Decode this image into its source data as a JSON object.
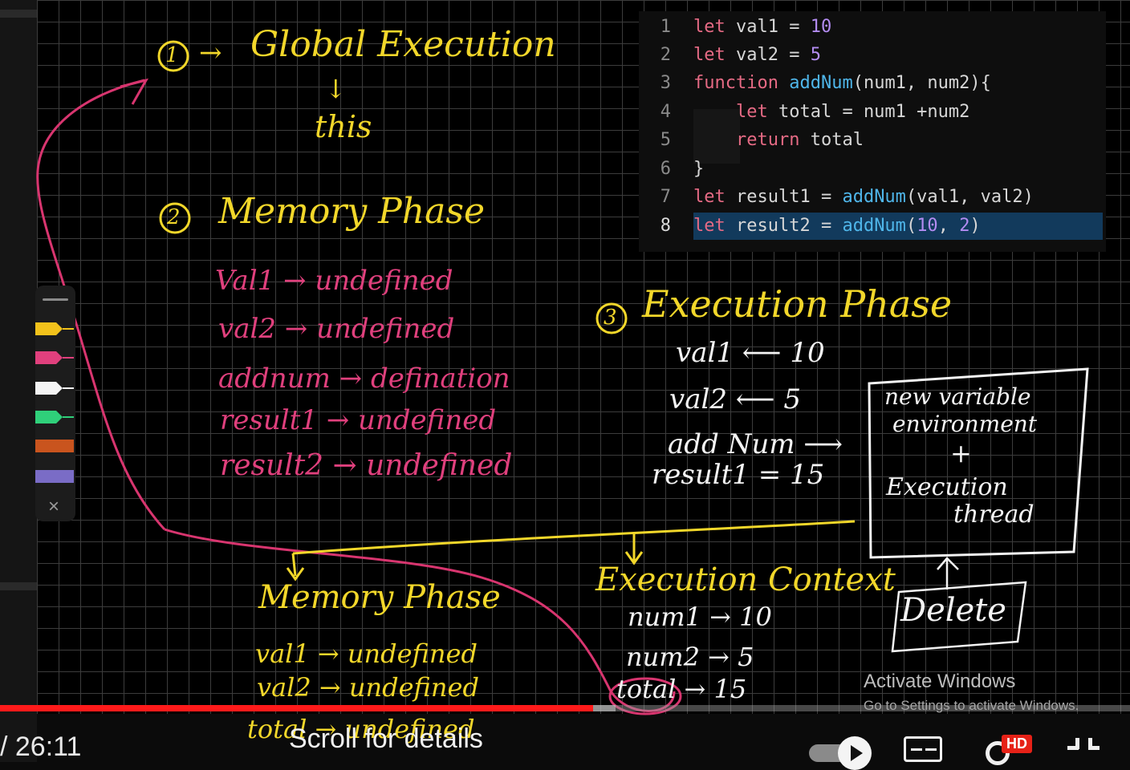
{
  "code": {
    "lines": [
      {
        "n": "1",
        "text": "let val1 = 10"
      },
      {
        "n": "2",
        "text": "let val2 = 5"
      },
      {
        "n": "3",
        "text": "function addNum(num1, num2){"
      },
      {
        "n": "4",
        "text": "    let total = num1 +num2"
      },
      {
        "n": "5",
        "text": "    return total"
      },
      {
        "n": "6",
        "text": "}"
      },
      {
        "n": "7",
        "text": "let result1 = addNum(val1, val2)"
      },
      {
        "n": "8",
        "text": "let result2 = addNum(10, 2)"
      }
    ]
  },
  "notes": {
    "global": {
      "num": "1",
      "arrow": "→",
      "title": "Global Execution",
      "down": "↓",
      "sub": "this"
    },
    "memory": {
      "num": "2",
      "title": "Memory Phase",
      "items": [
        "Val1 → undefined",
        "val2 → undefined",
        "addnum → defination",
        "result1 → undefined",
        "result2 → undefined"
      ]
    },
    "execution": {
      "num": "3",
      "title": "Execution Phase",
      "items": [
        "val1 ⟵ 10",
        "val2 ⟵ 5",
        "add Num ⟶",
        "result1 = 15"
      ]
    },
    "box": {
      "line1": "new variable",
      "line2": "environment",
      "plus": "+",
      "line3": "Execution",
      "line4": "thread"
    },
    "delete": {
      "arrow": "↑",
      "label": "Delete"
    },
    "inner_memory": {
      "title": "Memory Phase",
      "items": [
        "val1 → undefined",
        "val2 → undefined",
        "total → undefined"
      ]
    },
    "exec_context": {
      "title": "Execution Context",
      "items": [
        "num1 → 10",
        "num2 → 5",
        "total → 15"
      ]
    }
  },
  "tools": {
    "pens": [
      {
        "name": "yellow-pen",
        "color": "#f2c21b"
      },
      {
        "name": "pink-pen",
        "color": "#e0407d"
      },
      {
        "name": "white-pen",
        "color": "#f4f4f4"
      },
      {
        "name": "green-pen",
        "color": "#2fd07a"
      },
      {
        "name": "orange-highlighter",
        "color": "#c9541e"
      },
      {
        "name": "purple-highlighter",
        "color": "#7a6cc6"
      }
    ],
    "close_glyph": "×"
  },
  "player": {
    "time": "/ 26:11",
    "scroll_hint": "Scroll for details",
    "quality_badge": "HD",
    "progress": 0.525,
    "buffered": 0.545
  },
  "watermark": {
    "title": "Activate Windows",
    "sub": "Go to Settings to activate Windows."
  }
}
